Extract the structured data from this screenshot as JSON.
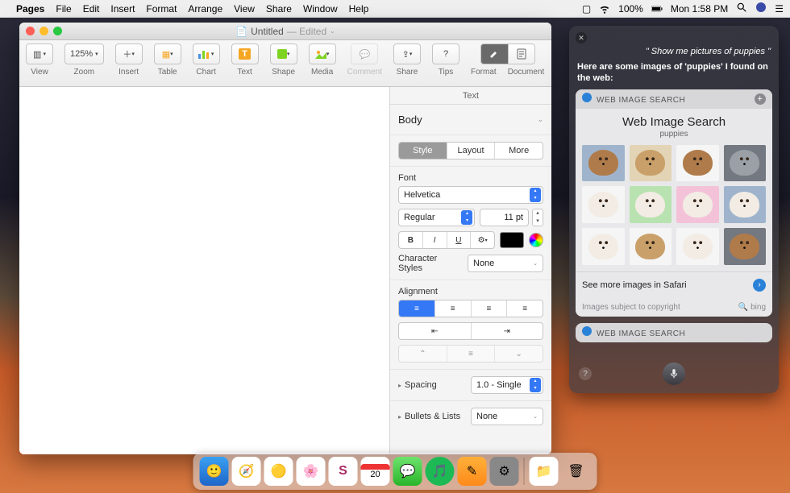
{
  "menubar": {
    "app": "Pages",
    "items": [
      "File",
      "Edit",
      "Insert",
      "Format",
      "Arrange",
      "View",
      "Share",
      "Window",
      "Help"
    ],
    "battery": "100%",
    "clock": "Mon 1:58 PM"
  },
  "window": {
    "title": "Untitled",
    "edited": "— Edited",
    "toolbar": {
      "view": "View",
      "zoom_value": "125%",
      "zoom": "Zoom",
      "insert": "Insert",
      "table": "Table",
      "chart": "Chart",
      "text": "Text",
      "shape": "Shape",
      "media": "Media",
      "comment": "Comment",
      "share": "Share",
      "tips": "Tips",
      "format": "Format",
      "document": "Document"
    }
  },
  "inspector": {
    "crumb": "Text",
    "paragraph_style": "Body",
    "tabs": {
      "style": "Style",
      "layout": "Layout",
      "more": "More"
    },
    "font_label": "Font",
    "font_family": "Helvetica",
    "font_style": "Regular",
    "font_size": "11 pt",
    "char_styles_label": "Character Styles",
    "char_styles_value": "None",
    "alignment_label": "Alignment",
    "spacing_label": "Spacing",
    "spacing_value": "1.0 - Single",
    "bullets_label": "Bullets & Lists",
    "bullets_value": "None"
  },
  "siri": {
    "quote": "\" Show me pictures of puppies \"",
    "reply": "Here are some images of 'puppies' I found on the web:",
    "card_head": "WEB IMAGE SEARCH",
    "card_title": "Web Image Search",
    "card_subtitle": "puppies",
    "see_more": "See more images in Safari",
    "credit": "Images subject to copyright",
    "provider": "bing"
  }
}
